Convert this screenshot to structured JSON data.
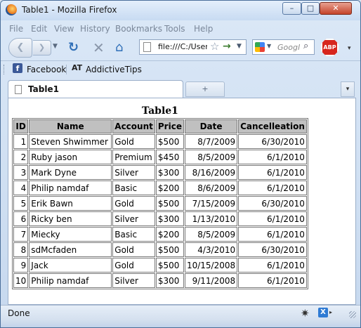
{
  "window": {
    "title": "Table1 - Mozilla Firefox",
    "minimize_glyph": "–",
    "maximize_glyph": "□",
    "close_glyph": "✕"
  },
  "menu": [
    "File",
    "Edit",
    "View",
    "History",
    "Bookmarks",
    "Tools",
    "Help"
  ],
  "navbar": {
    "back_glyph": "❮",
    "forward_glyph": "❯",
    "dropdown_glyph": "▼",
    "reload_glyph": "↻",
    "stop_glyph": "✕",
    "home_glyph": "⌂",
    "url": "file:///C:/Users/",
    "star_glyph": "☆",
    "go_glyph": "→",
    "search_placeholder": "Googl",
    "search_glyph": "⌕",
    "abp_label": "ABP",
    "more_glyph": "▾"
  },
  "bookmarks": {
    "items": [
      {
        "label": "Facebook",
        "icon": "facebook-icon",
        "icon_glyph": "f"
      },
      {
        "label": "AddictiveTips",
        "icon": "addictivetips-icon",
        "icon_glyph": "AT"
      }
    ]
  },
  "tabs": {
    "active_label": "Table1",
    "new_tab_glyph": "+",
    "list_glyph": "▾"
  },
  "table": {
    "caption": "Table1",
    "headers": [
      "ID",
      "Name",
      "Account",
      "Price",
      "Date",
      "Cancelleation"
    ],
    "rows": [
      [
        "1",
        "Steven Shwimmer",
        "Gold",
        "$500",
        "8/7/2009",
        "6/30/2010"
      ],
      [
        "2",
        "Ruby jason",
        "Premium",
        "$450",
        "8/5/2009",
        "6/1/2010"
      ],
      [
        "3",
        "Mark Dyne",
        "Silver",
        "$300",
        "8/16/2009",
        "6/1/2010"
      ],
      [
        "4",
        "Philip namdaf",
        "Basic",
        "$200",
        "8/6/2009",
        "6/1/2010"
      ],
      [
        "5",
        "Erik Bawn",
        "Gold",
        "$500",
        "7/15/2009",
        "6/30/2010"
      ],
      [
        "6",
        "Ricky ben",
        "Silver",
        "$300",
        "1/13/2010",
        "6/1/2010"
      ],
      [
        "7",
        "Miecky",
        "Basic",
        "$200",
        "8/5/2009",
        "6/1/2010"
      ],
      [
        "8",
        "sdMcfaden",
        "Gold",
        "$500",
        "4/3/2010",
        "6/30/2010"
      ],
      [
        "9",
        "Jack",
        "Gold",
        "$500",
        "10/15/2008",
        "6/1/2010"
      ],
      [
        "10",
        "Philip namdaf",
        "Silver",
        "$300",
        "9/11/2008",
        "6/1/2010"
      ]
    ]
  },
  "status": {
    "text": "Done",
    "bug_glyph": "✷",
    "ext_glyph": "X",
    "ext_drop_glyph": "▸"
  }
}
